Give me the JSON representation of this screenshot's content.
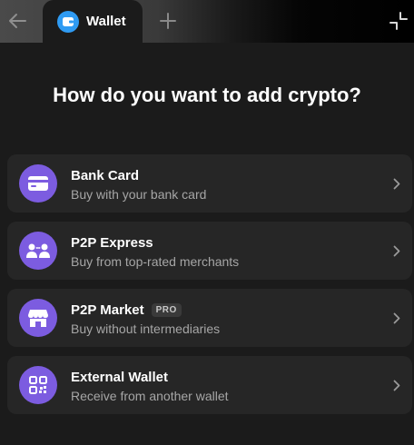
{
  "browser": {
    "tab": {
      "label": "Wallet",
      "icon": "wallet-icon"
    },
    "back_icon": "arrow-left-icon",
    "new_tab_icon": "plus-icon",
    "collapse_icon": "collapse-icon"
  },
  "main": {
    "heading": "How do you want to add crypto?",
    "options": [
      {
        "title": "Bank Card",
        "subtitle": "Buy with your bank card",
        "icon": "card-icon"
      },
      {
        "title": "P2P Express",
        "subtitle": "Buy from top-rated merchants",
        "icon": "people-exchange-icon"
      },
      {
        "title": "P2P Market",
        "badge": "PRO",
        "subtitle": "Buy without intermediaries",
        "icon": "store-icon"
      },
      {
        "title": "External Wallet",
        "subtitle": "Receive from another wallet",
        "icon": "qr-code-icon"
      }
    ]
  },
  "colors": {
    "accent": "#7c5ce0",
    "tab_icon": "#2f9bf3",
    "card_bg": "#262626",
    "page_bg": "#1b1b1b"
  }
}
